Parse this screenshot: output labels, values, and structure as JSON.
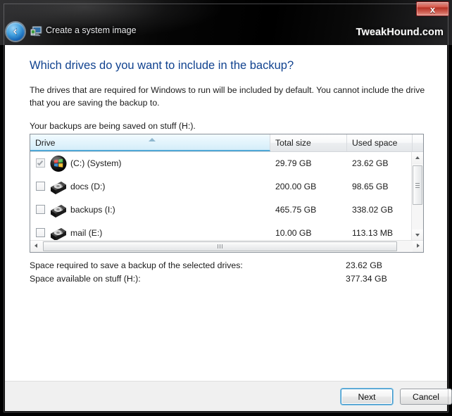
{
  "window": {
    "title": "Create a system image",
    "title_icon": "computer-image-icon",
    "back_icon": "back-arrow-icon",
    "close_label": "x",
    "watermark": "TweakHound.com"
  },
  "page": {
    "heading": "Which drives do you want to include in the backup?",
    "description": "The drives that are required for Windows to run will be included by default. You cannot include the drive that you are saving the backup to.",
    "saved_on": "Your backups are being saved on stuff (H:)."
  },
  "drive_list": {
    "columns": [
      {
        "key": "drive",
        "label": "Drive",
        "sorted": true,
        "sort_direction": "ascending"
      },
      {
        "key": "total",
        "label": "Total size",
        "sorted": false
      },
      {
        "key": "used",
        "label": "Used space",
        "sorted": false
      }
    ],
    "rows": [
      {
        "drive": "(C:) (System)",
        "total_size": "29.79 GB",
        "used_space": "23.62 GB",
        "checked": true,
        "disabled": true,
        "icon": "windows-logo-drive-icon"
      },
      {
        "drive": "docs (D:)",
        "total_size": "200.00 GB",
        "used_space": "98.65 GB",
        "checked": false,
        "disabled": false,
        "icon": "hard-drive-icon"
      },
      {
        "drive": "backups (I:)",
        "total_size": "465.75 GB",
        "used_space": "338.02 GB",
        "checked": false,
        "disabled": false,
        "icon": "hard-drive-icon"
      },
      {
        "drive": "mail (E:)",
        "total_size": "10.00 GB",
        "used_space": "113.13 MB",
        "checked": false,
        "disabled": false,
        "icon": "hard-drive-icon"
      }
    ]
  },
  "summary": {
    "required_label": "Space required to save a backup of the selected drives:",
    "required_value": "23.62 GB",
    "available_label": "Space available on stuff (H:):",
    "available_value": "377.34 GB"
  },
  "footer": {
    "next_label": "Next",
    "cancel_label": "Cancel"
  },
  "colors": {
    "heading_blue": "#10428f",
    "close_red": "#b52e22",
    "default_button_focus": "#3c94c8",
    "titlebar_black": "#000000"
  }
}
